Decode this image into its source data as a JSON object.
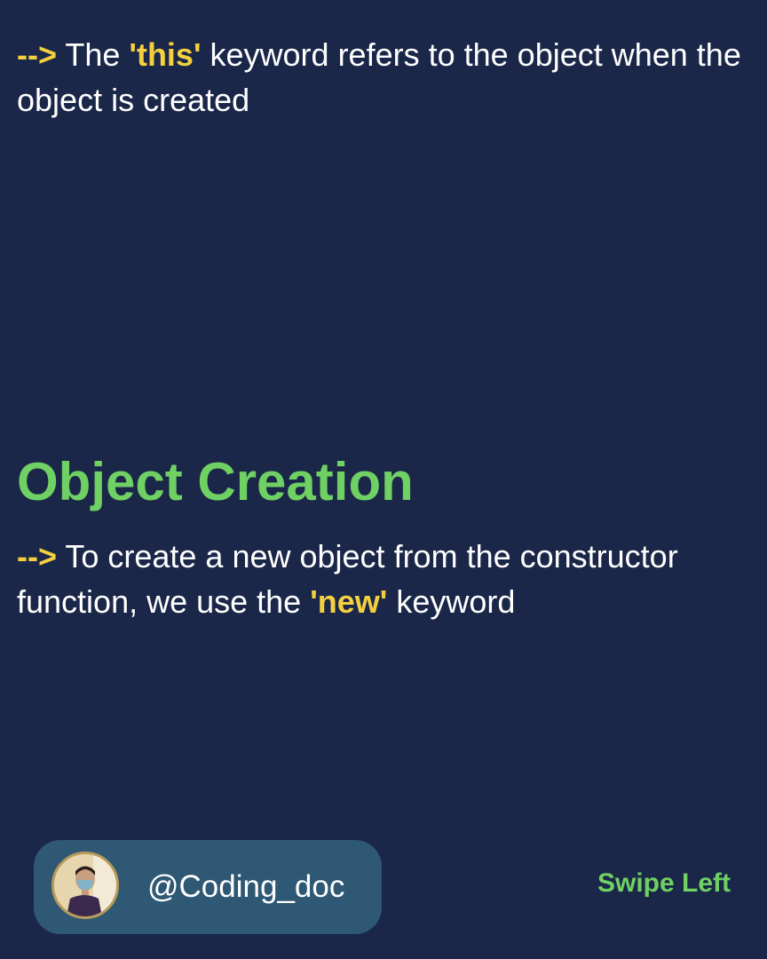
{
  "colors": {
    "background": "#1b2749",
    "accent_yellow": "#f4d03f",
    "accent_green": "#6fd063",
    "pill": "#2e5873",
    "text": "#ffffff"
  },
  "note_this": {
    "arrow": "-->",
    "before": " The ",
    "keyword": "'this'",
    "after": " keyword refers to the object when the object is created"
  },
  "section": {
    "heading": "Object Creation"
  },
  "note_new": {
    "arrow": "-->",
    "before": " To create a new object from the constructor function, we use the ",
    "keyword": "'new'",
    "after": " keyword"
  },
  "footer": {
    "avatar_icon": "profile-photo",
    "handle": "@Coding_doc",
    "swipe_label": "Swipe Left"
  }
}
